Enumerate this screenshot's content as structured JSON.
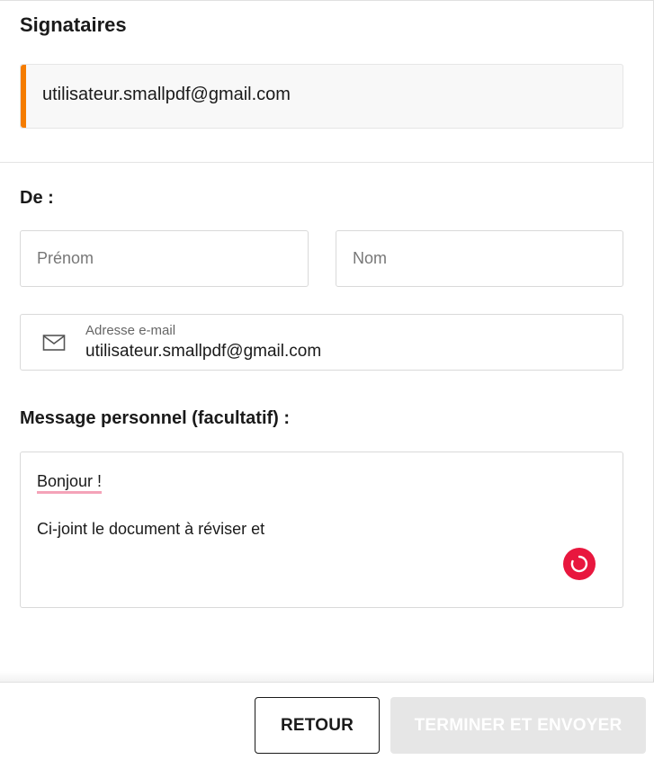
{
  "signers": {
    "title": "Signataires",
    "list": [
      {
        "email": "utilisateur.smallpdf@gmail.com"
      }
    ],
    "accent_color": "#f57c00"
  },
  "from": {
    "title": "De :",
    "first_name": {
      "placeholder": "Prénom",
      "value": ""
    },
    "last_name": {
      "placeholder": "Nom",
      "value": ""
    },
    "email": {
      "label": "Adresse e-mail",
      "value": "utilisateur.smallpdf@gmail.com",
      "icon": "envelope-icon"
    }
  },
  "message": {
    "title": "Message personnel (facultatif) :",
    "line_1": "Bonjour !",
    "line_2": "Ci-joint le document à réviser et",
    "spellcheck_underline_color": "#f4a3b8",
    "loader_color": "#e8173e"
  },
  "footer": {
    "back_label": "RETOUR",
    "submit_label": "TERMINER ET ENVOYER",
    "submit_disabled": true
  }
}
